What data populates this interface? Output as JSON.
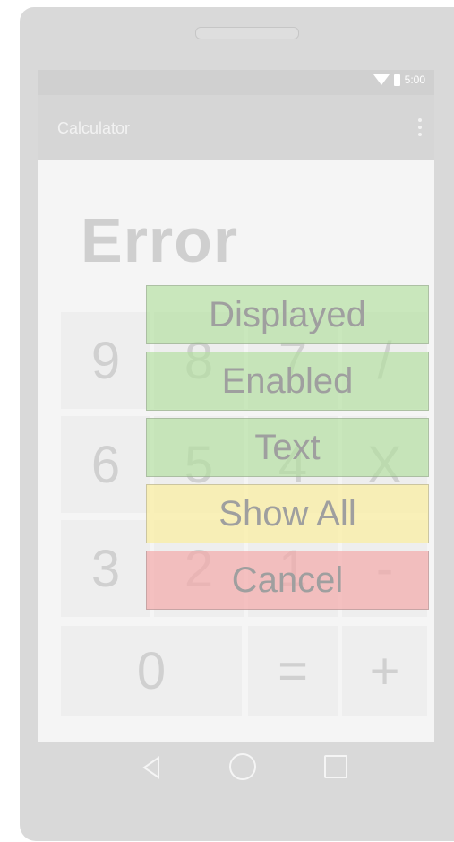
{
  "status_bar": {
    "time": "5:00",
    "wifi_icon": "wifi-icon",
    "battery_icon": "battery-icon"
  },
  "toolbar": {
    "title": "Calculator",
    "menu_icon": "more-vert-icon"
  },
  "display": {
    "value": "Error"
  },
  "keypad": {
    "k9": "9",
    "k8": "8",
    "k7": "7",
    "divide": "/",
    "k6": "6",
    "k5": "5",
    "k4": "4",
    "multiply": "X",
    "k3": "3",
    "k2": "2",
    "k1": "1",
    "minus": "-",
    "k0": "0",
    "equals": "=",
    "plus": "+"
  },
  "overlay_menu": {
    "displayed": "Displayed",
    "enabled": "Enabled",
    "text": "Text",
    "show_all": "Show All",
    "cancel": "Cancel"
  },
  "nav_bar": {
    "back_icon": "back-icon",
    "home_icon": "home-icon",
    "recents_icon": "recents-icon"
  },
  "colors": {
    "overlay_green": "#b0de9d",
    "overlay_yellow": "#faeea3",
    "overlay_red": "#f4aaaa"
  }
}
